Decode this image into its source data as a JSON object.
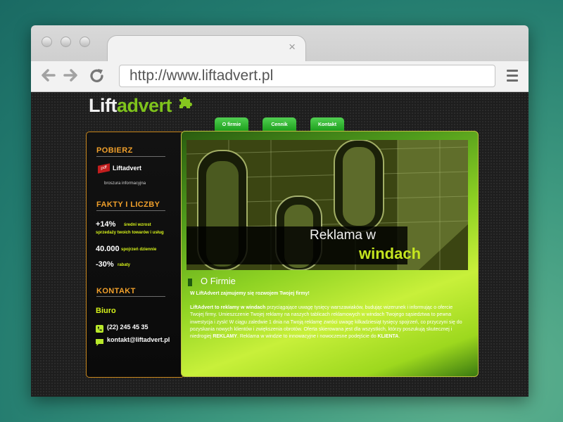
{
  "browser": {
    "url": "http://www.liftadvert.pl",
    "tab_close": "×",
    "icons": [
      "back-arrow-icon",
      "forward-arrow-icon",
      "reload-icon",
      "hamburger-menu-icon"
    ]
  },
  "site": {
    "logo": {
      "part1": "Lift",
      "part2": "advert"
    },
    "nav": [
      "O firmie",
      "Cennik",
      "Kontakt"
    ],
    "sidebar": {
      "download_heading": "POBIERZ",
      "pdf_badge": "pdf",
      "pdf_title": "Liftadvert",
      "pdf_subtitle": "broszura informacyjna",
      "facts_heading": "FAKTY I LICZBY",
      "fact1_value": "+14%",
      "fact1_label_a": "średni wzrost",
      "fact1_label_b": "sprzedaży twoich towarów i usług",
      "fact2_value": "40.000",
      "fact2_label": "spojrzeń dziennie",
      "fact3_value": "-30%",
      "fact3_label": "rabaty",
      "contact_heading": "KONTAKT",
      "office": "Biuro",
      "phone": "(22) 245 45 35",
      "email": "kontakt@liftadvert.pl"
    },
    "hero": {
      "line1": "Reklama w",
      "line2": "windach"
    },
    "section_title": "O Firmie",
    "lead": "W LiftAdvert zajmujemy się rozwojem Twojej firmy!",
    "para": {
      "t1": "LiftAdvert to reklamy w windach",
      "t2": " przyciągające uwagę tysięcy warszawiaków, budując wizerunek i informując o ofercie Twojej firmy. Umieszczenie Twojej reklamy na naszych tablicach reklamowych w windach Twojego sąsiedztwa to pewna inwestycja i zysk! W ciągu zaledwie 1 dnia na Twoją reklamę zwróci uwagę kilkadziesiąt tysięcy spojrzeń, co przyczyni się do pozyskania nowych klientów i zwiększenia obrotów. Oferta skierowana jest dla wszystkich, którzy poszukują skutecznej i niedrogiej ",
      "t3": "REKLAMY",
      "t4": ". Reklama w windzie to innowacyjne i nowoczesne podejście do ",
      "t5": "KLIENTA",
      "t6": "."
    },
    "colors": {
      "accent_green": "#7fc31c",
      "accent_orange": "#f1a02b",
      "nav_green": "#2fb52f"
    }
  }
}
